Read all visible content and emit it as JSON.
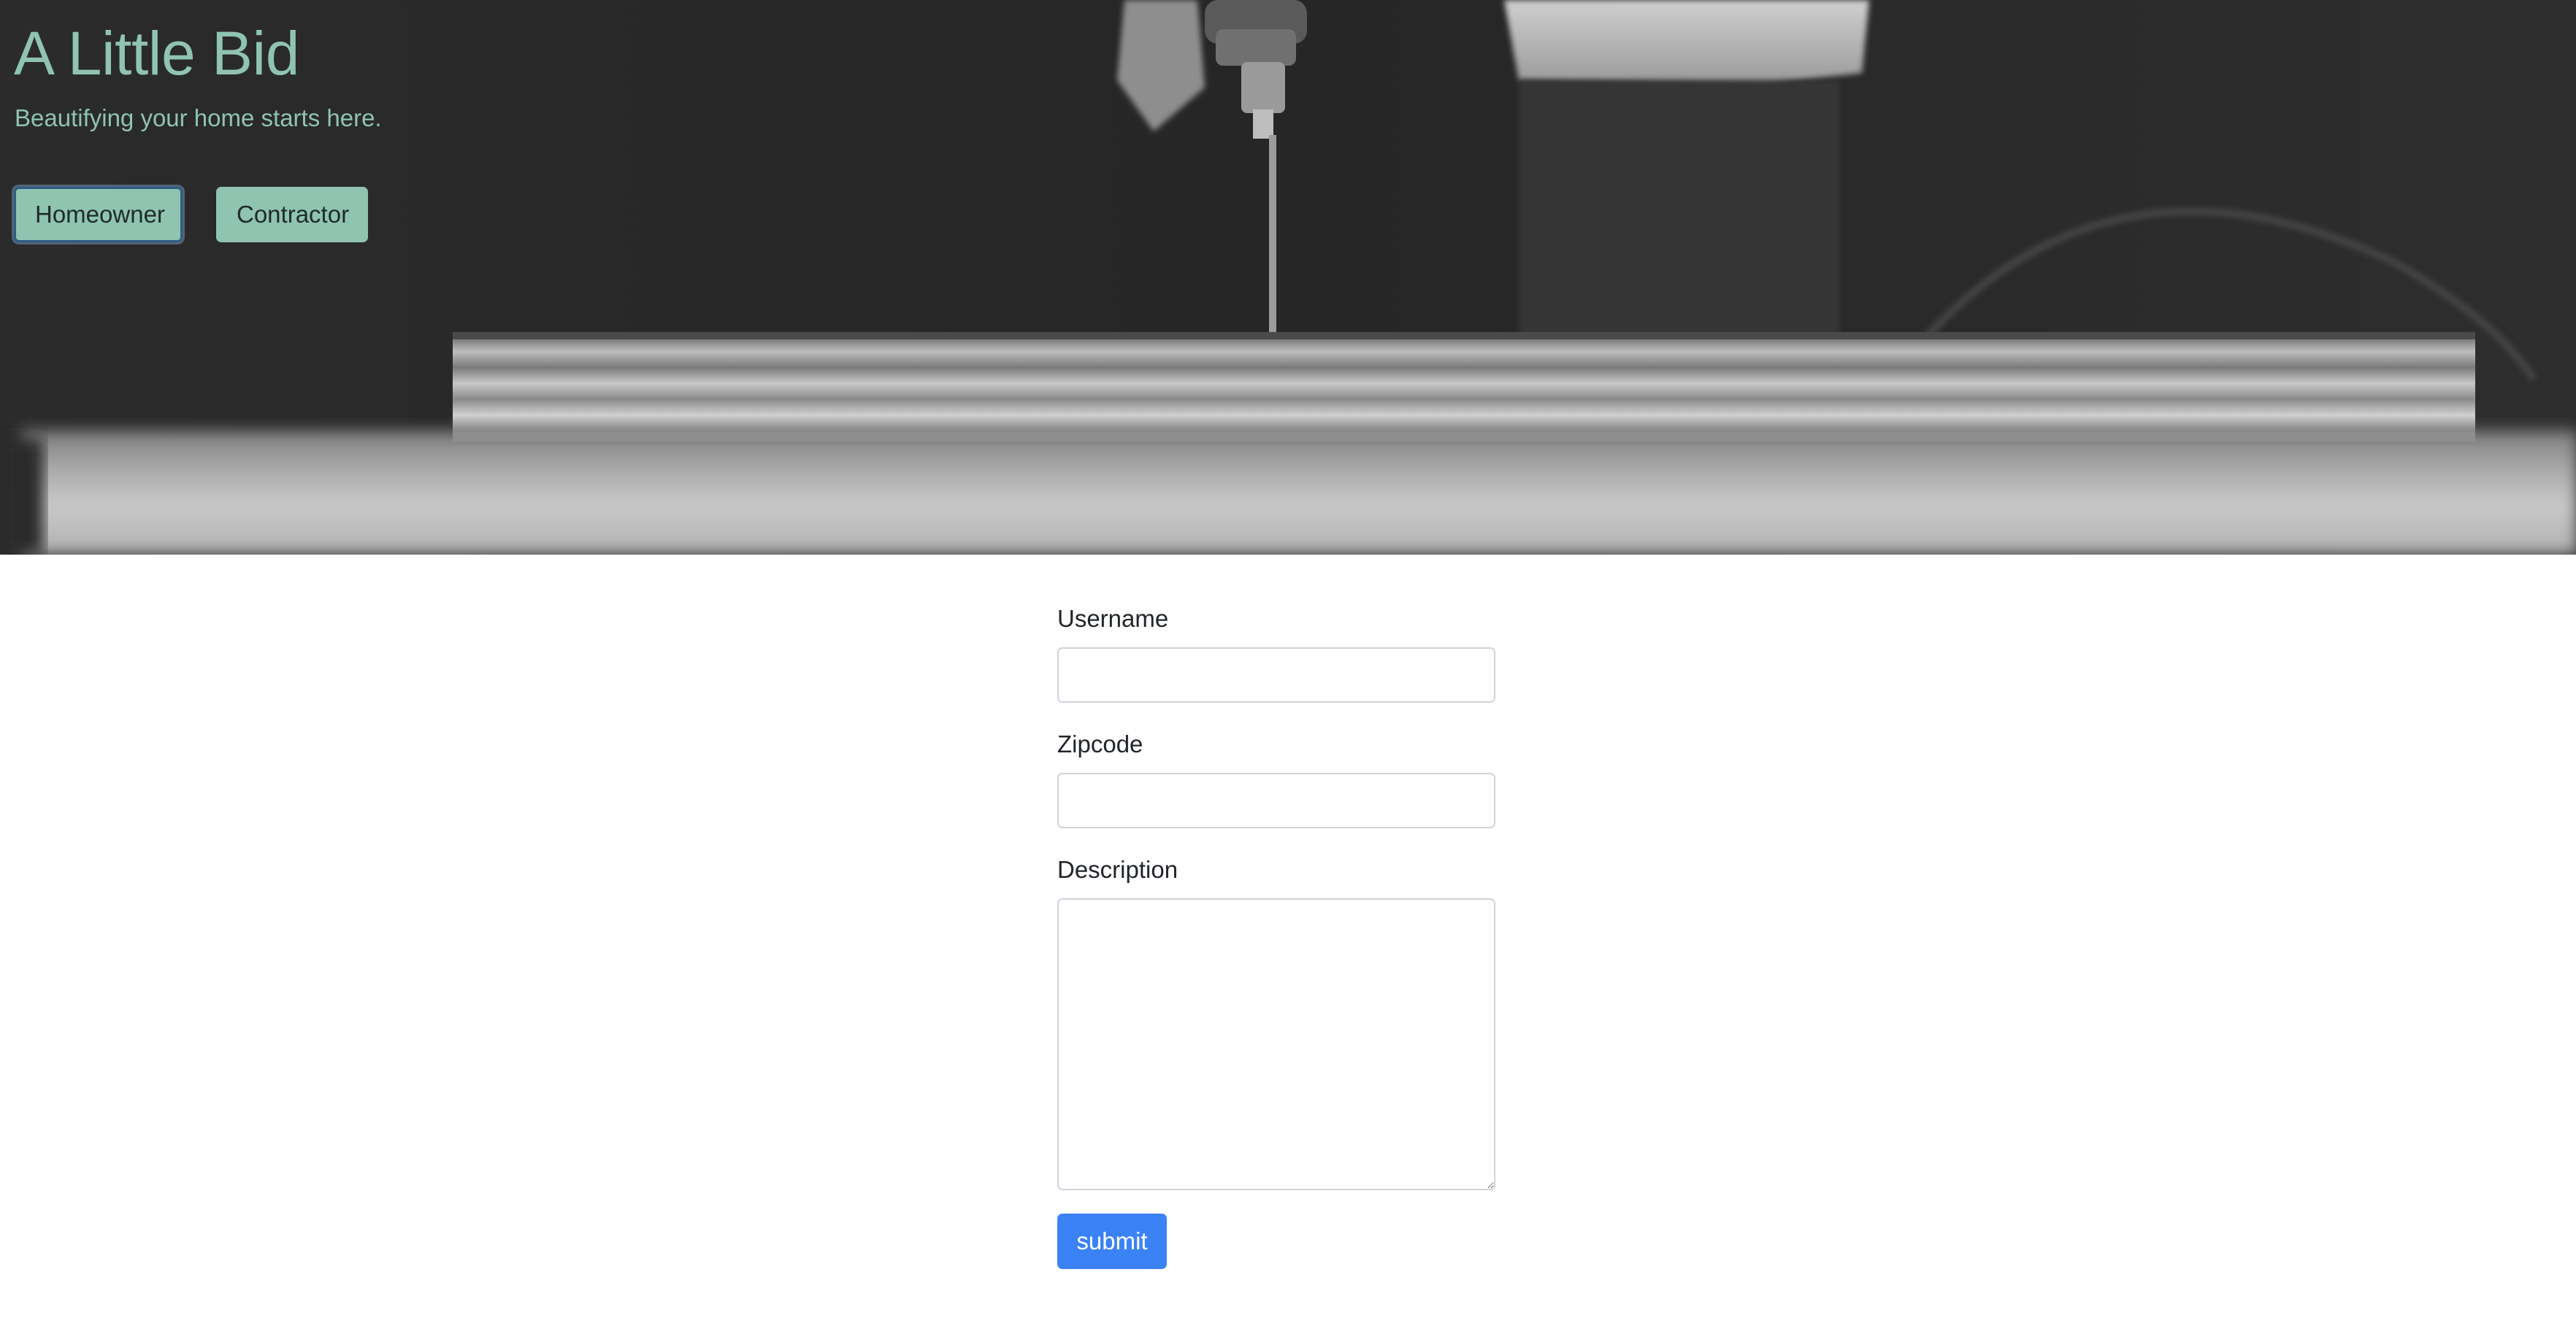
{
  "hero": {
    "title": "A Little Bid",
    "tagline": "Beautifying your home starts here.",
    "roles": {
      "homeowner_label": "Homeowner",
      "contractor_label": "Contractor"
    },
    "background": "black-and-white photo of a drill driving a screw into stacked plywood"
  },
  "form": {
    "username_label": "Username",
    "username_value": "",
    "zipcode_label": "Zipcode",
    "zipcode_value": "",
    "description_label": "Description",
    "description_value": "",
    "submit_label": "submit"
  },
  "colors": {
    "brand_accent": "#8fc4b0",
    "hero_background": "#2a2a2a",
    "submit_button": "#3b82f6",
    "input_border": "#ced4da",
    "label_text": "#212529"
  }
}
